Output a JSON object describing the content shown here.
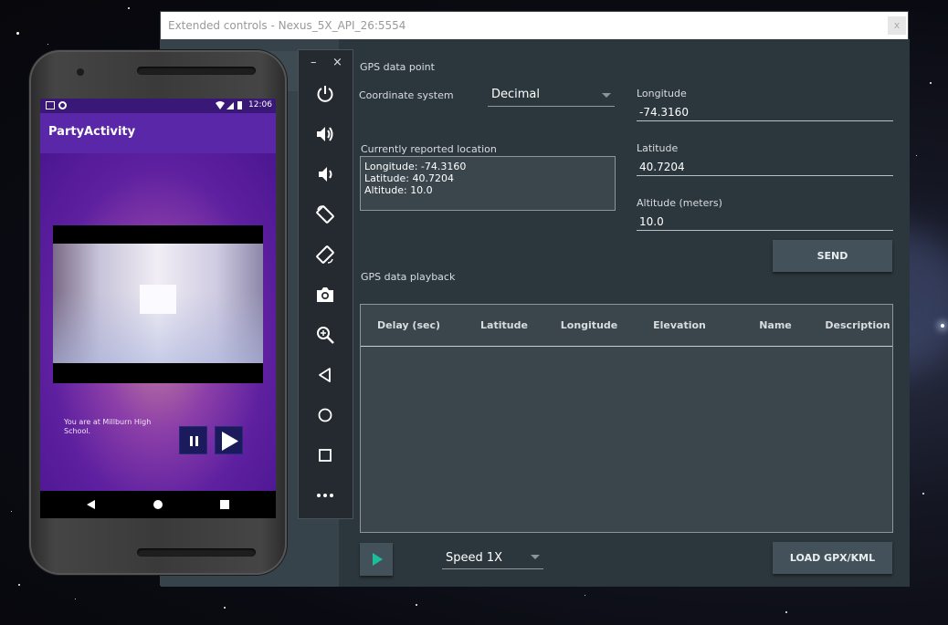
{
  "window": {
    "title": "Extended controls - Nexus_5X_API_26:5554",
    "close_label": "x"
  },
  "location": {
    "gps_data_point_label": "GPS data point",
    "coordinate_system_label": "Coordinate system",
    "coordinate_system_value": "Decimal",
    "longitude_label": "Longitude",
    "longitude_value": "-74.3160",
    "latitude_label": "Latitude",
    "latitude_value": "40.7204",
    "altitude_label": "Altitude (meters)",
    "altitude_value": "10.0",
    "reported_label": "Currently reported location",
    "reported_lines": [
      "Longitude: -74.3160",
      "Latitude: 40.7204",
      "Altitude: 10.0"
    ],
    "send_label": "SEND",
    "playback_label": "GPS data playback",
    "table_headers": [
      "Delay (sec)",
      "Latitude",
      "Longitude",
      "Elevation",
      "Name",
      "Description"
    ],
    "speed_value": "Speed 1X",
    "load_label": "LOAD GPX/KML",
    "accent_color": "#1bbf9b"
  },
  "toolbar": {
    "minimize_label": "–",
    "close_label": "×",
    "icons": [
      "power-icon",
      "volume-up-icon",
      "volume-down-icon",
      "rotate-left-icon",
      "rotate-right-icon",
      "camera-icon",
      "zoom-icon",
      "back-icon",
      "home-icon",
      "overview-icon",
      "more-icon"
    ]
  },
  "phone": {
    "time": "12:06",
    "app_title": "PartyActivity",
    "caption": "You are at Millburn High School.",
    "appbar_color": "#5a27a8"
  }
}
